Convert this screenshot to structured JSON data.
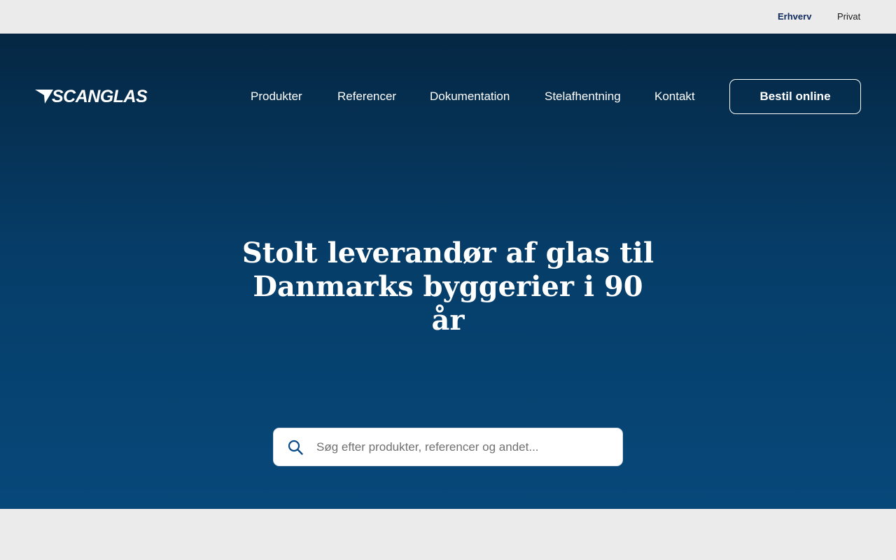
{
  "topbar": {
    "links": [
      {
        "label": "Erhverv",
        "active": true
      },
      {
        "label": "Privat",
        "active": false
      }
    ]
  },
  "header": {
    "logo_text": "SCANGLAS",
    "nav": [
      "Produkter",
      "Referencer",
      "Dokumentation",
      "Stelafhentning",
      "Kontakt"
    ],
    "cta_label": "Bestil online"
  },
  "hero": {
    "title_line1": "Stolt leverandør af glas til",
    "title_line2": "Danmarks byggerier i 90 år"
  },
  "search": {
    "placeholder": "Søg efter produkter, referencer og andet...",
    "icon": "search-icon"
  },
  "colors": {
    "hero_top": "#052743",
    "hero_bottom": "#07487a",
    "accent_dark": "#0e2a5c",
    "page_bg": "#ebebeb"
  }
}
